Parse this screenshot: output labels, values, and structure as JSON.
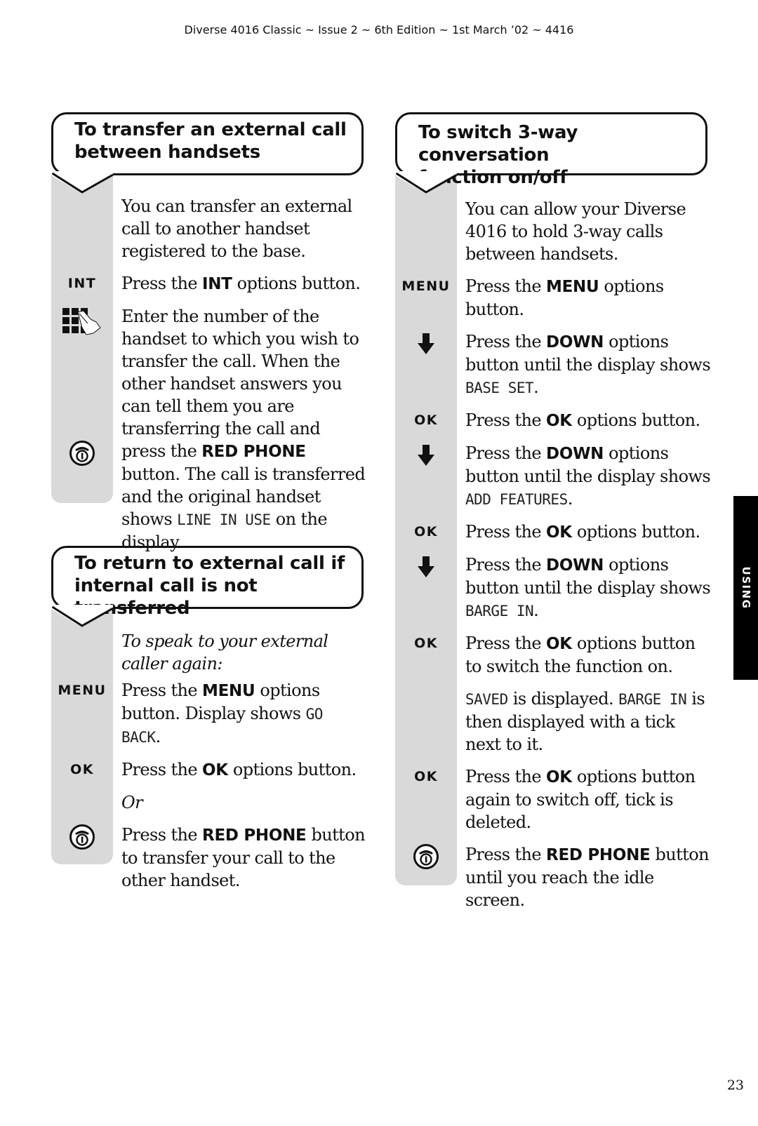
{
  "running_head": "Diverse 4016 Classic ~ Issue 2 ~ 6th Edition ~ 1st March ’02 ~ 4416",
  "side_tab": "USING",
  "page_number": "23",
  "sections": [
    {
      "title_line1": "To transfer an external call",
      "title_line2": "between handsets",
      "steps": [
        {
          "icon": "none",
          "parts": [
            "You can transfer an external call to another handset registered to the base."
          ]
        },
        {
          "icon": "INT",
          "pre": "Press the ",
          "bold": "INT",
          "post": " options button."
        },
        {
          "icon": "keypad-icon",
          "text": "Enter the number of the handset to which you wish to transfer the call. When the other handset answers you can tell them you are transferring the call and"
        },
        {
          "icon": "red-phone-icon",
          "pre": "press the ",
          "bold": "RED PHONE",
          "post": " button. The call is transferred and the original handset shows ",
          "lcd": "LINE IN USE",
          "post2": " on the display."
        }
      ]
    },
    {
      "title_line1": "To return to external call if",
      "title_line2": "internal call is not transferred",
      "steps": [
        {
          "icon": "none",
          "italic": "To speak to your external caller again:"
        },
        {
          "icon": "MENU",
          "pre": "Press the ",
          "bold": "MENU",
          "post": " options button. Display shows ",
          "lcd": "GO BACK",
          "post2": "."
        },
        {
          "icon": "OK",
          "pre": "Press the ",
          "bold": "OK",
          "post": " options button."
        },
        {
          "icon": "none",
          "italic": "Or"
        },
        {
          "icon": "red-phone-icon",
          "pre": "Press the ",
          "bold": "RED PHONE",
          "post": " button to transfer your call to the other handset."
        }
      ]
    },
    {
      "title_line1": "To switch 3-way conversation",
      "title_line2": "function on/off",
      "steps": [
        {
          "icon": "none",
          "text": "You can allow your Diverse 4016 to hold 3-way calls between handsets."
        },
        {
          "icon": "MENU",
          "pre": "Press the ",
          "bold": "MENU",
          "post": " options button."
        },
        {
          "icon": "down-arrow-icon",
          "pre": "Press the ",
          "bold": "DOWN",
          "post": " options button until the display shows ",
          "lcd": "BASE SET",
          "post2": "."
        },
        {
          "icon": "OK",
          "pre": "Press the ",
          "bold": "OK",
          "post": " options button."
        },
        {
          "icon": "down-arrow-icon",
          "pre": "Press the ",
          "bold": "DOWN",
          "post": " options button until the display shows ",
          "lcd": "ADD FEATURES",
          "post2": "."
        },
        {
          "icon": "OK",
          "pre": "Press the ",
          "bold": "OK",
          "post": " options button."
        },
        {
          "icon": "down-arrow-icon",
          "pre": "Press the ",
          "bold": "DOWN",
          "post": " options button until the display shows ",
          "lcd": "BARGE IN",
          "post2": "."
        },
        {
          "icon": "OK",
          "pre": "Press the ",
          "bold": "OK",
          "post": " options button to switch the function on."
        },
        {
          "icon": "none",
          "lcd_a": "SAVED",
          "mid": " is displayed. ",
          "lcd_b": "BARGE IN",
          "post": " is then displayed with a tick next to it."
        },
        {
          "icon": "OK",
          "pre": "Press the ",
          "bold": "OK",
          "post": " options button again to switch off, tick is deleted."
        },
        {
          "icon": "red-phone-icon",
          "pre": "Press the ",
          "bold": "RED PHONE",
          "post": " button until you reach the idle screen."
        }
      ]
    }
  ]
}
